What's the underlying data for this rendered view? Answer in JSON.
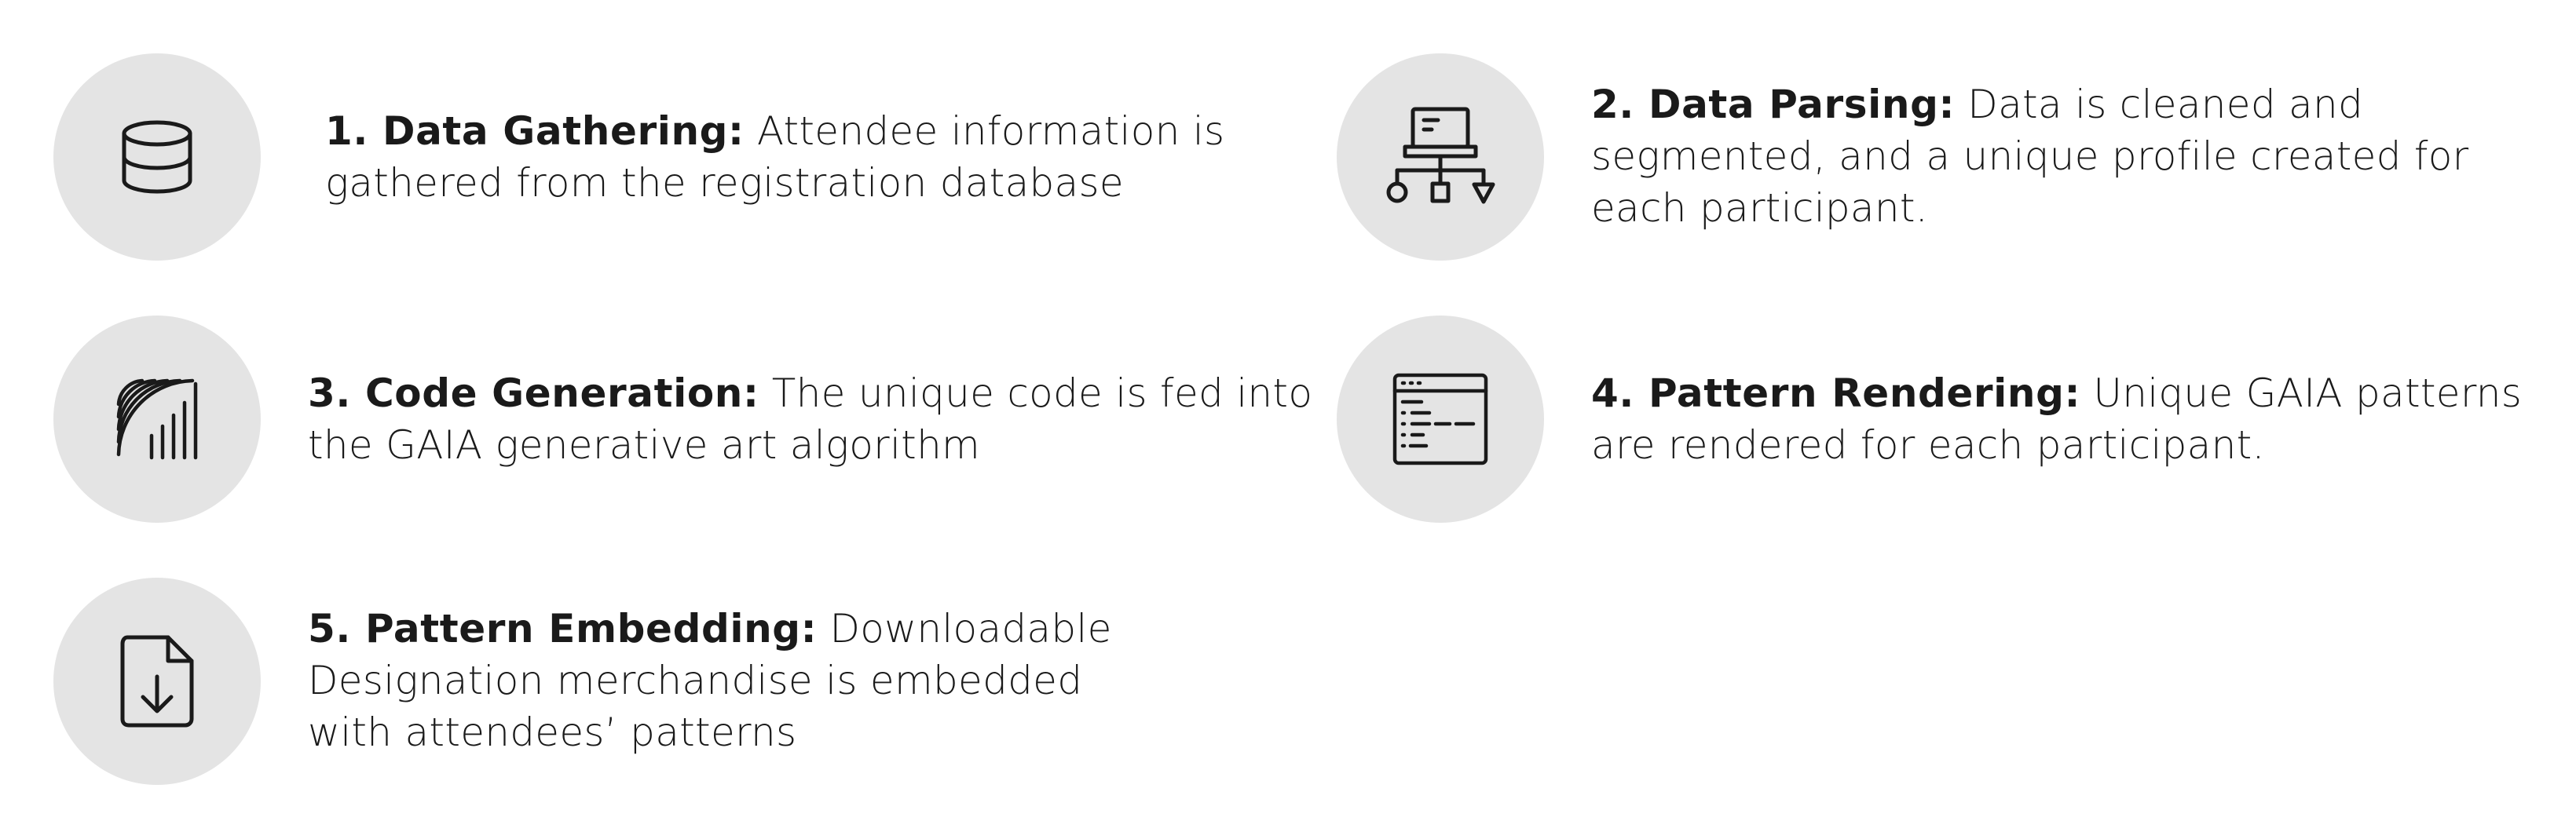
{
  "steps": [
    {
      "icon": "database-icon",
      "title": "1. Data Gathering:",
      "body": "Attendee information is gathered from the registration database"
    },
    {
      "icon": "network-computer-icon",
      "title": "2. Data Parsing:",
      "body": "Data is cleaned and segmented, and a unique profile created for each participant."
    },
    {
      "icon": "generative-lines-icon",
      "title": "3. Code Generation:",
      "body": "The unique code is fed into the GAIA generative art algorithm"
    },
    {
      "icon": "code-window-icon",
      "title": "4. Pattern Rendering:",
      "body": "Unique GAIA patterns are rendered for each participant."
    },
    {
      "icon": "file-download-icon",
      "title": "5. Pattern Embedding:",
      "body": "Downloadable Designation merchandise is embedded with attendees’ patterns"
    }
  ]
}
